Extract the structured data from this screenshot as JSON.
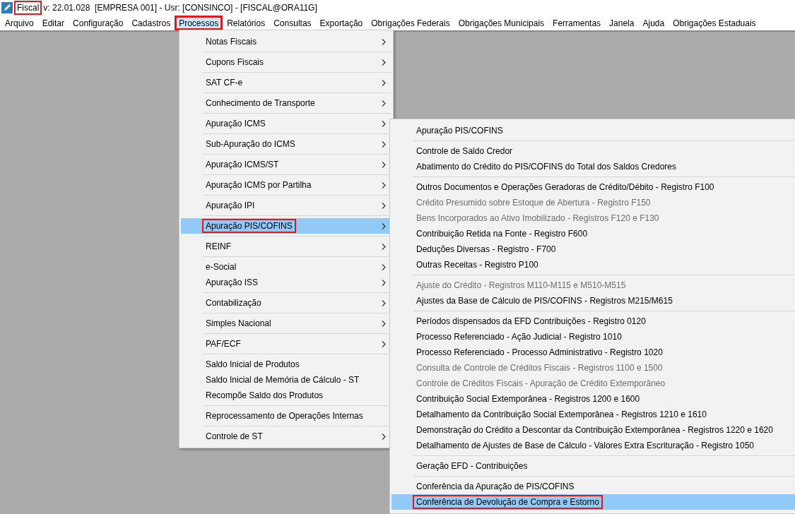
{
  "window": {
    "app_name": {
      "text": "Fiscal",
      "marked": true
    },
    "title": "v: 22.01.028  [EMPRESA 001] - Usr: [CONSINCO] - [FISCAL@ORA11G]"
  },
  "menubar": [
    {
      "label": "Arquivo",
      "selected": false,
      "marked": false
    },
    {
      "label": "Editar",
      "selected": false,
      "marked": false
    },
    {
      "label": "Configuração",
      "selected": false,
      "marked": false
    },
    {
      "label": "Cadastros",
      "selected": false,
      "marked": false
    },
    {
      "label": "Processos",
      "selected": true,
      "marked": true
    },
    {
      "label": "Relatórios",
      "selected": false,
      "marked": false
    },
    {
      "label": "Consultas",
      "selected": false,
      "marked": false
    },
    {
      "label": "Exportação",
      "selected": false,
      "marked": false
    },
    {
      "label": "Obrigações Federais",
      "selected": false,
      "marked": false
    },
    {
      "label": "Obrigações Municipais",
      "selected": false,
      "marked": false
    },
    {
      "label": "Ferramentas",
      "selected": false,
      "marked": false
    },
    {
      "label": "Janela",
      "selected": false,
      "marked": false
    },
    {
      "label": "Ajuda",
      "selected": false,
      "marked": false
    },
    {
      "label": "Obrigações Estaduais",
      "selected": false,
      "marked": false
    }
  ],
  "processos_menu": {
    "groups": [
      [
        {
          "label": "Notas Fiscais",
          "submenu": true,
          "selected": false,
          "marked": false
        }
      ],
      [
        {
          "label": "Cupons Fiscais",
          "submenu": true,
          "selected": false,
          "marked": false
        }
      ],
      [
        {
          "label": "SAT CF-e",
          "submenu": true,
          "selected": false,
          "marked": false
        }
      ],
      [
        {
          "label": "Conhecimento de Transporte",
          "submenu": true,
          "selected": false,
          "marked": false
        }
      ],
      [
        {
          "label": "Apuração ICMS",
          "submenu": true,
          "selected": false,
          "marked": false
        }
      ],
      [
        {
          "label": "Sub-Apuração do ICMS",
          "submenu": true,
          "selected": false,
          "marked": false
        }
      ],
      [
        {
          "label": "Apuração ICMS/ST",
          "submenu": true,
          "selected": false,
          "marked": false
        }
      ],
      [
        {
          "label": "Apuração ICMS por Partilha",
          "submenu": true,
          "selected": false,
          "marked": false
        }
      ],
      [
        {
          "label": "Apuração IPI",
          "submenu": true,
          "selected": false,
          "marked": false
        }
      ],
      [
        {
          "label": "Apuração PIS/COFINS",
          "submenu": true,
          "selected": true,
          "marked": true
        }
      ],
      [
        {
          "label": "REINF",
          "submenu": true,
          "selected": false,
          "marked": false
        }
      ],
      [
        {
          "label": "e-Social",
          "submenu": true,
          "selected": false,
          "marked": false
        },
        {
          "label": "Apuração ISS",
          "submenu": true,
          "selected": false,
          "marked": false
        }
      ],
      [
        {
          "label": "Contabilização",
          "submenu": true,
          "selected": false,
          "marked": false
        }
      ],
      [
        {
          "label": "Simples Nacional",
          "submenu": true,
          "selected": false,
          "marked": false
        }
      ],
      [
        {
          "label": "PAF/ECF",
          "submenu": true,
          "selected": false,
          "marked": false
        }
      ],
      [
        {
          "label": "Saldo Inicial de Produtos",
          "submenu": false,
          "selected": false,
          "marked": false
        },
        {
          "label": "Saldo Inicial de Memória de Cálculo - ST",
          "submenu": false,
          "selected": false,
          "marked": false
        },
        {
          "label": "Recompõe Saldo dos Produtos",
          "submenu": false,
          "selected": false,
          "marked": false
        }
      ],
      [
        {
          "label": "Reprocessamento de Operações Internas",
          "submenu": false,
          "selected": false,
          "marked": false
        }
      ],
      [
        {
          "label": "Controle de ST",
          "submenu": true,
          "selected": false,
          "marked": false
        }
      ]
    ]
  },
  "submenu": {
    "groups": [
      [
        {
          "label": "Apuração PIS/COFINS",
          "disabled": false,
          "selected": false,
          "marked": false
        }
      ],
      [
        {
          "label": "Controle de Saldo Credor",
          "disabled": false,
          "selected": false,
          "marked": false
        },
        {
          "label": "Abatimento do Crédito do PIS/COFINS do Total dos Saldos Credores",
          "disabled": false,
          "selected": false,
          "marked": false
        }
      ],
      [
        {
          "label": "Outros Documentos e Operações Geradoras de Crédito/Débito - Registro F100",
          "disabled": false,
          "selected": false,
          "marked": false
        },
        {
          "label": "Crédito Presumido sobre Estoque de Abertura - Registro F150",
          "disabled": true,
          "selected": false,
          "marked": false
        },
        {
          "label": "Bens Incorporados ao Ativo Imobilizado - Registros F120 e F130",
          "disabled": true,
          "selected": false,
          "marked": false
        },
        {
          "label": "Contribuição Retida na Fonte - Registro F600",
          "disabled": false,
          "selected": false,
          "marked": false
        },
        {
          "label": "Deduções Diversas - Registro - F700",
          "disabled": false,
          "selected": false,
          "marked": false
        },
        {
          "label": "Outras Receitas - Registro P100",
          "disabled": false,
          "selected": false,
          "marked": false
        }
      ],
      [
        {
          "label": "Ajuste do Crédito - Registros M110-M115 e M510-M515",
          "disabled": true,
          "selected": false,
          "marked": false
        },
        {
          "label": "Ajustes da Base de Cálculo de PIS/COFINS - Registros M215/M615",
          "disabled": false,
          "selected": false,
          "marked": false
        }
      ],
      [
        {
          "label": "Períodos dispensados da EFD Contribuições - Registro 0120",
          "disabled": false,
          "selected": false,
          "marked": false
        },
        {
          "label": "Processo Referenciado - Ação Judicial - Registro 1010",
          "disabled": false,
          "selected": false,
          "marked": false
        },
        {
          "label": "Processo Referenciado - Processo Administrativo - Registro 1020",
          "disabled": false,
          "selected": false,
          "marked": false
        },
        {
          "label": "Consulta de Controle de Créditos Fiscais - Registros 1100 e 1500",
          "disabled": true,
          "selected": false,
          "marked": false
        },
        {
          "label": "Controle de Créditos Fiscais - Apuração de Crédito Extemporâneo",
          "disabled": true,
          "selected": false,
          "marked": false
        },
        {
          "label": "Contribuição Social Extemporânea - Registros 1200 e 1600",
          "disabled": false,
          "selected": false,
          "marked": false
        },
        {
          "label": "Detalhamento da Contribuição Social Extemporânea - Registros 1210 e 1610",
          "disabled": false,
          "selected": false,
          "marked": false
        },
        {
          "label": "Demonstração do Crédito a Descontar da Contribuição Extemporânea - Registros 1220 e 1620",
          "disabled": false,
          "selected": false,
          "marked": false
        },
        {
          "label": "Detalhamento de Ajustes de Base de Cálculo - Valores Extra Escrituração - Registro 1050",
          "disabled": false,
          "selected": false,
          "marked": false
        }
      ],
      [
        {
          "label": "Geração EFD - Contribuições",
          "disabled": false,
          "selected": false,
          "marked": false
        }
      ],
      [
        {
          "label": "Conferência da Apuração de PIS/COFINS",
          "disabled": false,
          "selected": false,
          "marked": false
        },
        {
          "label": "Conferência de Devolução de Compra e Estorno",
          "disabled": false,
          "selected": true,
          "marked": true
        }
      ]
    ]
  }
}
